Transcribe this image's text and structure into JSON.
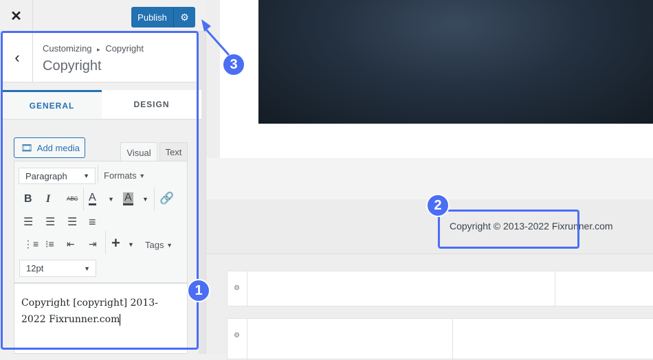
{
  "topbar": {
    "close_icon": "close-icon",
    "publish_label": "Publish",
    "publish_settings_icon": "gear-icon"
  },
  "section": {
    "breadcrumb_root": "Customizing",
    "breadcrumb_separator": "▸",
    "breadcrumb_current": "Copyright",
    "title": "Copyright"
  },
  "tabs": [
    {
      "label": "GENERAL",
      "active": true
    },
    {
      "label": "DESIGN",
      "active": false
    }
  ],
  "editor": {
    "add_media_label": "Add media",
    "mode_tabs": [
      {
        "label": "Visual",
        "active": true
      },
      {
        "label": "Text",
        "active": false
      }
    ],
    "paragraph_select": "Paragraph",
    "formats_label": "Formats",
    "tags_label": "Tags",
    "font_size_select": "12pt",
    "content_line1": "Copyright [copyright] 2013-",
    "content_line2": "2022 Fixrunner.com"
  },
  "preview": {
    "copyright_text": "Copyright © 2013-2022 Fixrunner.com"
  },
  "annotations": {
    "badge1": "1",
    "badge2": "2",
    "badge3": "3",
    "color": "#4b6ef5"
  },
  "colors": {
    "accent": "#2271b1"
  }
}
